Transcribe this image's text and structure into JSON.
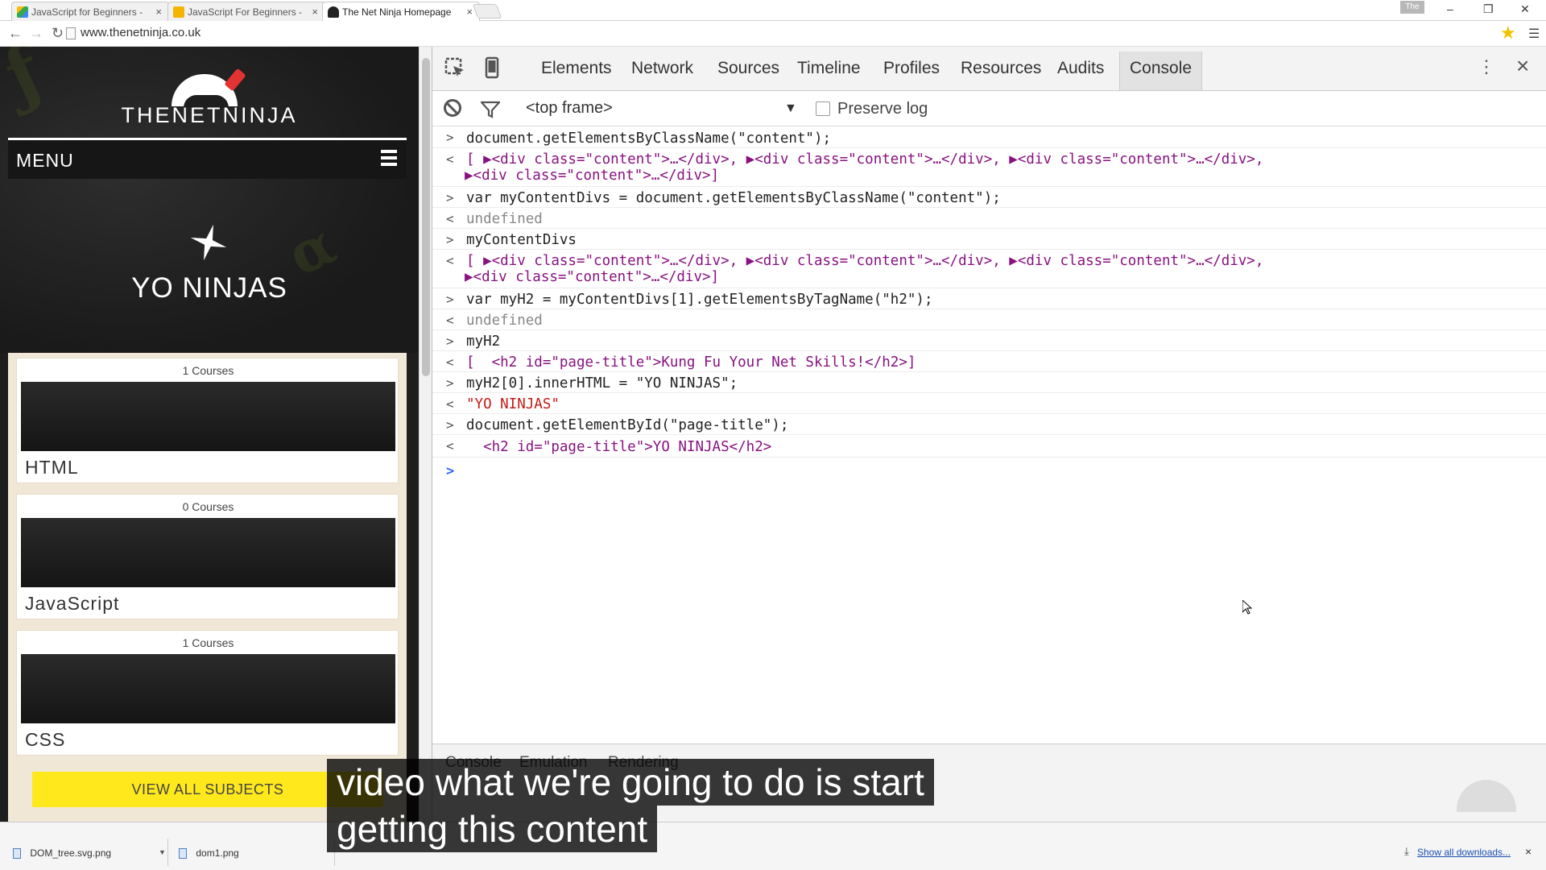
{
  "browser": {
    "tabs": [
      {
        "title": "JavaScript for Beginners -",
        "icon": "google-drive-icon",
        "active": false
      },
      {
        "title": "JavaScript For Beginners -",
        "icon": "slides-icon",
        "active": false
      },
      {
        "title": "The Net Ninja Homepage",
        "icon": "net-ninja-icon",
        "active": true
      }
    ],
    "tab_close": "×",
    "profile_badge": "The",
    "url": "www.thenetninja.co.uk",
    "window_controls": [
      "–",
      "❐",
      "✕"
    ]
  },
  "site": {
    "logo_text": "THENETNINJA",
    "menu_label": "MENU",
    "hero_title": "YO NINJAS",
    "courses": [
      {
        "count": "1 Courses",
        "name": "HTML"
      },
      {
        "count": "0 Courses",
        "name": "JavaScript"
      },
      {
        "count": "1 Courses",
        "name": "CSS"
      }
    ],
    "view_all": "VIEW ALL SUBJECTS"
  },
  "devtools": {
    "tabs": [
      "Elements",
      "Network",
      "Sources",
      "Timeline",
      "Profiles",
      "Resources",
      "Audits",
      "Console"
    ],
    "active_tab": "Console",
    "frame": "<top frame>",
    "preserve_log": "Preserve log",
    "console_lines": [
      {
        "type": "input",
        "text": "document.getElementsByClassName(\"content\");"
      },
      {
        "type": "output",
        "text": "[ ▶<div class=\"content\">…</div>, ▶<div class=\"content\">…</div>, ▶<div class=\"content\">…</div>,"
      },
      {
        "type": "output-cont",
        "text": "▶<div class=\"content\">…</div>]"
      },
      {
        "type": "input",
        "text": "var myContentDivs = document.getElementsByClassName(\"content\");"
      },
      {
        "type": "output",
        "text": "undefined"
      },
      {
        "type": "input",
        "text": "myContentDivs"
      },
      {
        "type": "output",
        "text": "[ ▶<div class=\"content\">…</div>, ▶<div class=\"content\">…</div>, ▶<div class=\"content\">…</div>,"
      },
      {
        "type": "output-cont",
        "text": "▶<div class=\"content\">…</div>]"
      },
      {
        "type": "input",
        "text": "var myH2 = myContentDivs[1].getElementsByTagName(\"h2\");"
      },
      {
        "type": "output",
        "text": "undefined"
      },
      {
        "type": "input",
        "text": "myH2"
      },
      {
        "type": "output",
        "text": "[  <h2 id=\"page-title\">Kung Fu Your Net Skills!</h2>]"
      },
      {
        "type": "input",
        "text": "myH2[0].innerHTML = \"YO NINJAS\";"
      },
      {
        "type": "output",
        "text": "\"YO NINJAS\""
      },
      {
        "type": "input",
        "text": "document.getElementById(\"page-title\");"
      },
      {
        "type": "output",
        "text": "  <h2 id=\"page-title\">YO NINJAS</h2>"
      }
    ],
    "drawer_tabs": [
      "Console",
      "Emulation",
      "Rendering"
    ]
  },
  "downloads": {
    "items": [
      "DOM_tree.svg.png",
      "dom1.png"
    ],
    "show_all": "Show all downloads...",
    "close": "×"
  },
  "subtitle": {
    "line1": "video what we're going to do is start",
    "line2": "getting this content"
  }
}
